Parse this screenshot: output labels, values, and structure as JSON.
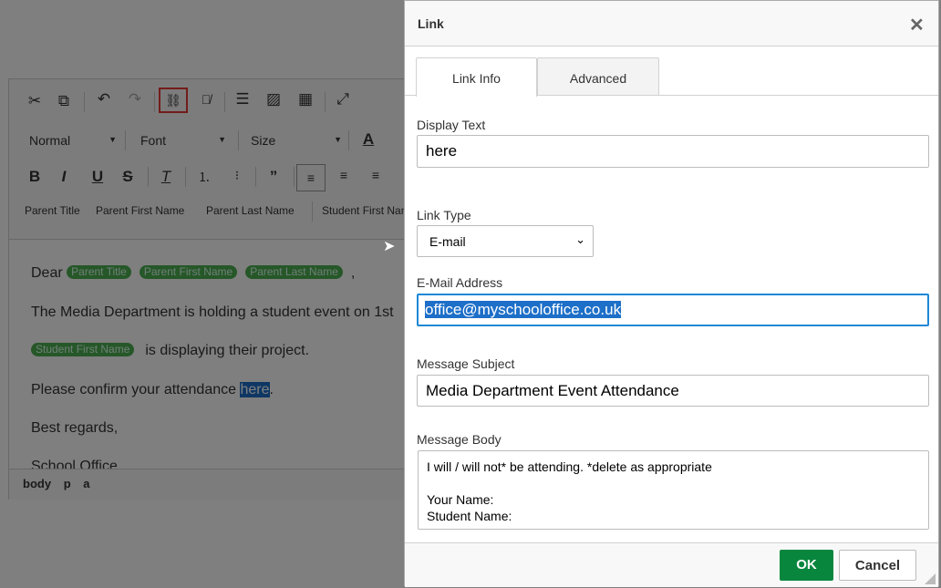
{
  "editor": {
    "toolbar": {
      "icons": [
        "cut-icon",
        "copy-icon",
        "undo-icon",
        "redo-icon",
        "link-icon",
        "unlink-icon",
        "horizontal-rule-icon",
        "image-icon",
        "table-icon",
        "maximize-icon",
        "bold-icon",
        "italic-icon",
        "underline-icon",
        "strikethrough-icon",
        "remove-format-icon",
        "numbered-list-icon",
        "bulleted-list-icon",
        "blockquote-icon",
        "align-left-icon",
        "align-center-icon",
        "align-right-icon",
        "text-color-icon"
      ],
      "format": "Normal",
      "font": "Font",
      "size": "Size",
      "bold": "B",
      "italic": "I",
      "underline": "U",
      "strike": "S",
      "placeholders": [
        "Parent Title",
        "Parent First Name",
        "Parent Last Name",
        "Student First Name"
      ]
    },
    "content": {
      "dear": "Dear",
      "comma": ",",
      "line2": "The Media Department is holding a student event on 1st",
      "line3": "is displaying their project.",
      "line4_pre": "Please confirm your attendance ",
      "line4_link": "here",
      "line4_post": ".",
      "line5": "Best regards,",
      "line6": "School Office"
    },
    "path": [
      "body",
      "p",
      "a"
    ],
    "highlight_color": "#e53935"
  },
  "dialog": {
    "title": "Link",
    "tabs": [
      {
        "label": "Link Info",
        "active": true
      },
      {
        "label": "Advanced",
        "active": false
      }
    ],
    "display_text_label": "Display Text",
    "display_text": "here",
    "link_type_label": "Link Type",
    "link_type": "E-mail",
    "email_label": "E-Mail Address",
    "email": "office@myschooloffice.co.uk",
    "subject_label": "Message Subject",
    "subject": "Media Department Event Attendance",
    "body_label": "Message Body",
    "body": "I will / will not* be attending. *delete as appropriate\n\nYour Name:\nStudent Name:",
    "ok": "OK",
    "cancel": "Cancel",
    "ok_color": "#09863e"
  }
}
